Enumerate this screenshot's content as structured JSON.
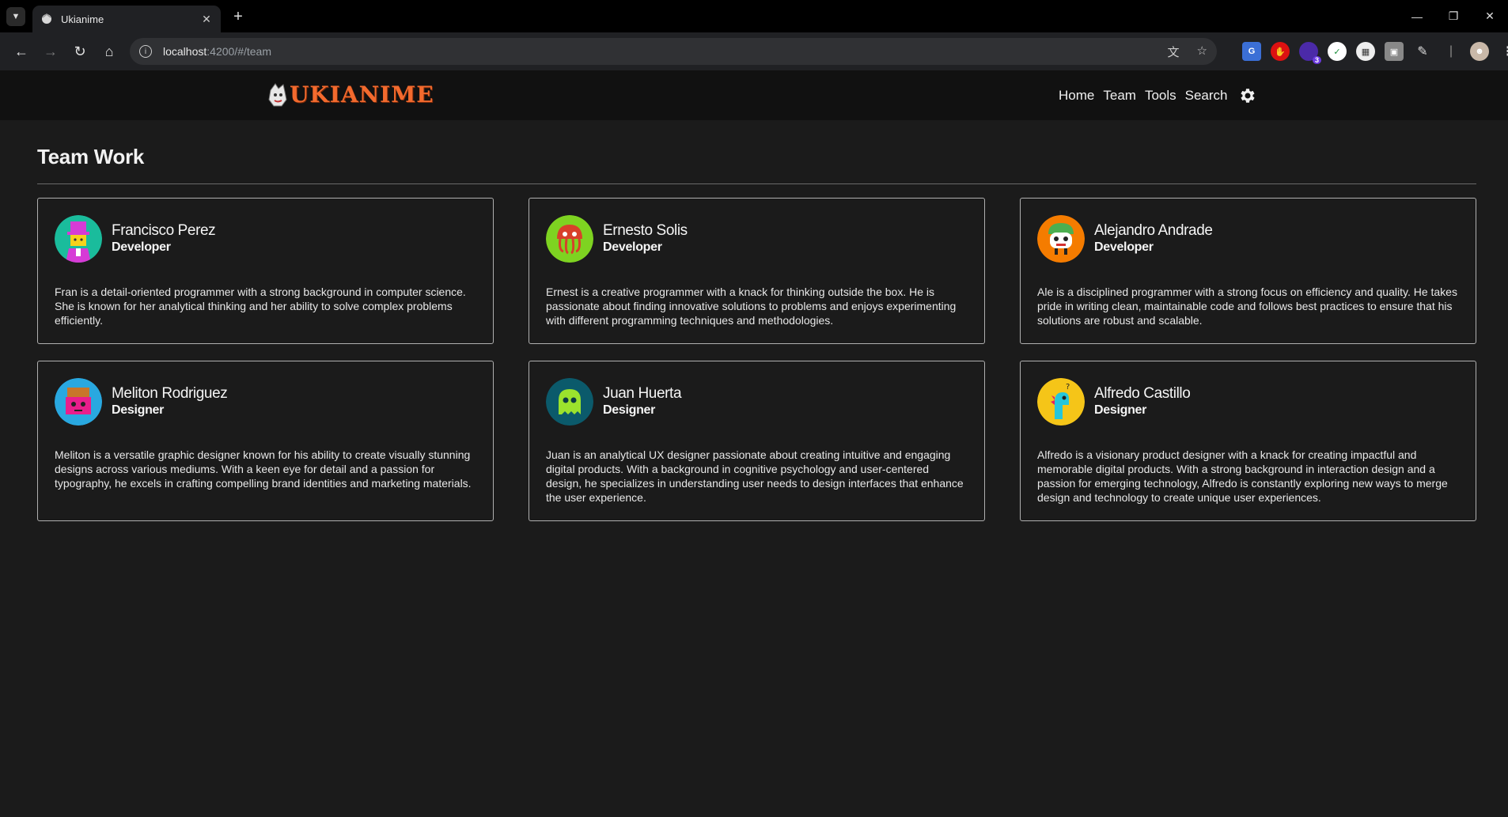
{
  "browser": {
    "tab_title": "Ukianime",
    "url_host": "localhost",
    "url_path": ":4200/#/team",
    "extension_badge": "3"
  },
  "app": {
    "logo_text": "UKIANIME",
    "nav": [
      {
        "label": "Home"
      },
      {
        "label": "Team"
      },
      {
        "label": "Tools"
      },
      {
        "label": "Search"
      }
    ]
  },
  "page": {
    "title": "Team Work"
  },
  "team": [
    {
      "name": "Francisco Perez",
      "role": "Developer",
      "bio": "Fran is a detail-oriented programmer with a strong background in computer science. She is known for her analytical thinking and her ability to solve complex problems efficiently.",
      "avatar_icon": "top-hat-person-icon",
      "avatar_color": "#1abc9c"
    },
    {
      "name": "Ernesto Solis",
      "role": "Developer",
      "bio": "Ernest is a creative programmer with a knack for thinking outside the box. He is passionate about finding innovative solutions to problems and enjoys experimenting with different programming techniques and methodologies.",
      "avatar_icon": "octopus-icon",
      "avatar_color": "#7ed321"
    },
    {
      "name": "Alejandro Andrade",
      "role": "Developer",
      "bio": "Ale is a disciplined programmer with a strong focus on efficiency and quality. He takes pride in writing clean, maintainable code and follows best practices to ensure that his solutions are robust and scalable.",
      "avatar_icon": "mushroom-face-icon",
      "avatar_color": "#f57c00"
    },
    {
      "name": "Meliton Rodriguez",
      "role": "Designer",
      "bio": "Meliton is a versatile graphic designer known for his ability to create visually stunning designs across various mediums. With a keen eye for detail and a passion for typography, he excels in crafting compelling brand identities and marketing materials.",
      "avatar_icon": "robot-face-icon",
      "avatar_color": "#29a8e0"
    },
    {
      "name": "Juan Huerta",
      "role": "Designer",
      "bio": "Juan is an analytical UX designer passionate about creating intuitive and engaging digital products. With a background in cognitive psychology and user-centered design, he specializes in understanding user needs to design interfaces that enhance the user experience.",
      "avatar_icon": "ghost-icon",
      "avatar_color": "#0b5a6b"
    },
    {
      "name": "Alfredo Castillo",
      "role": "Designer",
      "bio": "Alfredo is a visionary product designer with a knack for creating impactful and memorable digital products. With a strong background in interaction design and a passion for emerging technology, Alfredo is constantly exploring new ways to merge design and technology to create unique user experiences.",
      "avatar_icon": "dinosaur-icon",
      "avatar_color": "#f5c518"
    }
  ]
}
